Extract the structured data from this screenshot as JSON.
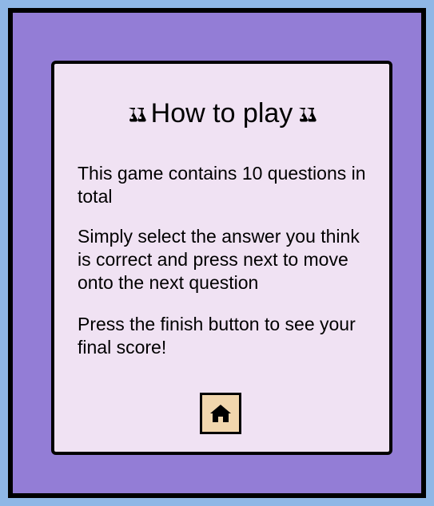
{
  "panel": {
    "title": "How to play",
    "title_icon": "flask-icon",
    "paragraphs": [
      "This game contains 10 questions in total",
      "Simply select the answer you think is correct and press next to move onto the next question",
      "Press the finish button to see your final score!"
    ],
    "home_icon": "home-icon"
  },
  "colors": {
    "page_background": "#8fb7e6",
    "frame_background": "#937dd6",
    "card_background": "#f0e2f3",
    "home_button_background": "#f1d6ad",
    "border": "#000000"
  }
}
